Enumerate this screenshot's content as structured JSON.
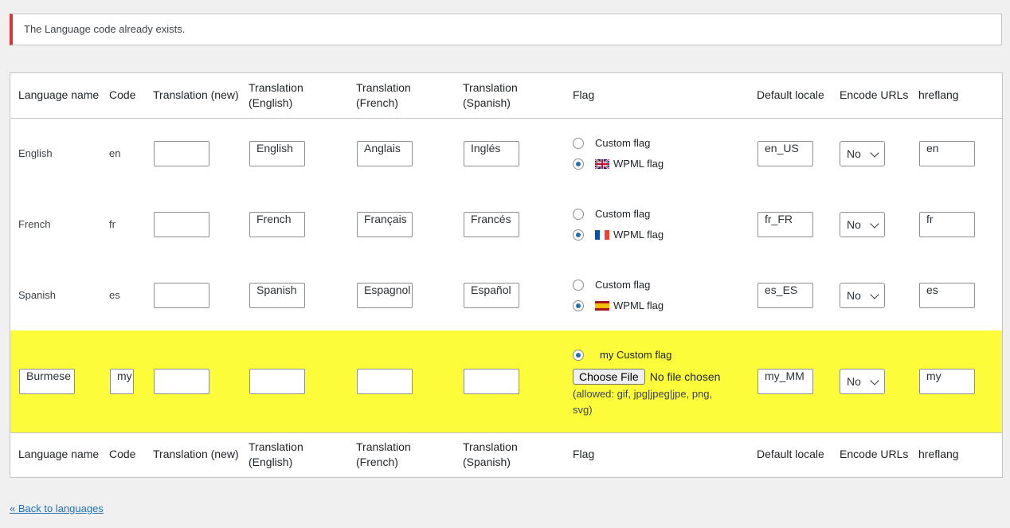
{
  "notice": {
    "message": "The Language code already exists."
  },
  "headers": {
    "language_name": "Language name",
    "code": "Code",
    "translation_new": "Translation (new)",
    "translation_english": "Translation (English)",
    "translation_french": "Translation (French)",
    "translation_spanish": "Translation (Spanish)",
    "flag": "Flag",
    "default_locale": "Default locale",
    "encode_urls": "Encode URLs",
    "hreflang": "hreflang"
  },
  "flag_options": {
    "custom_label": "Custom flag",
    "wpml_label": "WPML flag",
    "choose_file_label": "Choose File",
    "no_file_label": "No file chosen",
    "allowed_text": "(allowed: gif, jpg|jpeg|jpe, png, svg)",
    "broken_image_alt": "my Custom flag"
  },
  "rows": [
    {
      "name": "English",
      "code": "en",
      "translation_new": "",
      "translation_english": "English",
      "translation_french": "Anglais",
      "translation_spanish": "Inglés",
      "flag_selected": "wpml",
      "flag_icon": "uk-flag-icon",
      "default_locale": "en_US",
      "encode_urls": "No",
      "hreflang": "en"
    },
    {
      "name": "French",
      "code": "fr",
      "translation_new": "",
      "translation_english": "French",
      "translation_french": "Français",
      "translation_spanish": "Francés",
      "flag_selected": "wpml",
      "flag_icon": "france-flag-icon",
      "default_locale": "fr_FR",
      "encode_urls": "No",
      "hreflang": "fr"
    },
    {
      "name": "Spanish",
      "code": "es",
      "translation_new": "",
      "translation_english": "Spanish",
      "translation_french": "Espagnol",
      "translation_spanish": "Español",
      "flag_selected": "wpml",
      "flag_icon": "spain-flag-icon",
      "default_locale": "es_ES",
      "encode_urls": "No",
      "hreflang": "es"
    }
  ],
  "new_row": {
    "name": "Burmese",
    "code": "my",
    "translation_new": "",
    "translation_english": "",
    "translation_french": "",
    "translation_spanish": "",
    "flag_selected": "custom",
    "default_locale": "my_MM",
    "encode_urls": "No",
    "hreflang": "my"
  },
  "back_link": "« Back to languages",
  "colors": {
    "highlight": "#fcfc3a",
    "error_border": "#d63638",
    "link": "#2271b1",
    "radio_checked": "#2271b1"
  }
}
